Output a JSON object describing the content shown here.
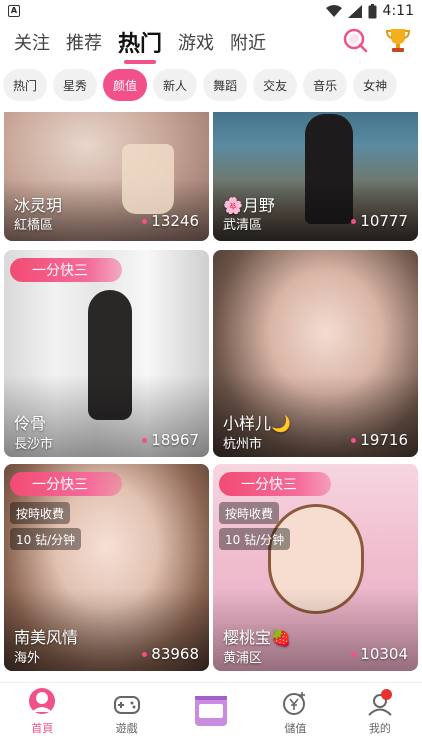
{
  "status": {
    "time": "4:11"
  },
  "top_tabs": [
    "关注",
    "推荐",
    "热门",
    "游戏",
    "附近"
  ],
  "active_tab": "热门",
  "chips": [
    "热门",
    "星秀",
    "颜值",
    "新人",
    "舞蹈",
    "交友",
    "音乐",
    "女神"
  ],
  "active_chip": "颜值",
  "cards": [
    {
      "name": "冰灵玥",
      "city": "紅橋區",
      "count": "13246"
    },
    {
      "name": "🌸月野",
      "city": "武清區",
      "count": "10777"
    },
    {
      "name": "伶骨",
      "city": "長沙市",
      "count": "18967",
      "ribbon": "一分快三"
    },
    {
      "name": "小样儿🌙",
      "city": "杭州市",
      "count": "19716"
    },
    {
      "name": "南美风情",
      "city": "海外",
      "count": "83968",
      "ribbon": "一分快三",
      "tag1": "按時收費",
      "tag2": "10 钻/分钟"
    },
    {
      "name": "樱桃宝🍓",
      "city": "黄浦区",
      "count": "10304",
      "ribbon": "一分快三",
      "tag1": "按時收費",
      "tag2": "10 钻/分钟"
    }
  ],
  "bottom_nav": [
    "首頁",
    "遊戲",
    "",
    "儲值",
    "我的"
  ],
  "colors": {
    "accent": "#f2508a",
    "ribbon": "#f14c73",
    "badge": "#e8322f"
  }
}
